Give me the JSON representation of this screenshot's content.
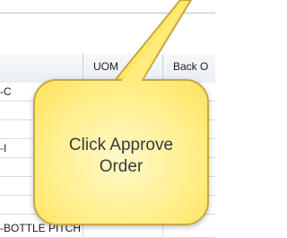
{
  "grid": {
    "columns": {
      "uom": "UOM",
      "back_order": "Back O"
    },
    "rows": [
      {
        "text": "-C"
      },
      {
        "text": ""
      },
      {
        "text": ""
      },
      {
        "text": "-I"
      },
      {
        "text": ""
      },
      {
        "text": ""
      },
      {
        "text": ""
      },
      {
        "text": "-BOTTLE PITCH"
      }
    ]
  },
  "callout": {
    "message": "Click Approve\nOrder",
    "fill_color": "#ffef8a",
    "border_color": "#c9a646"
  }
}
